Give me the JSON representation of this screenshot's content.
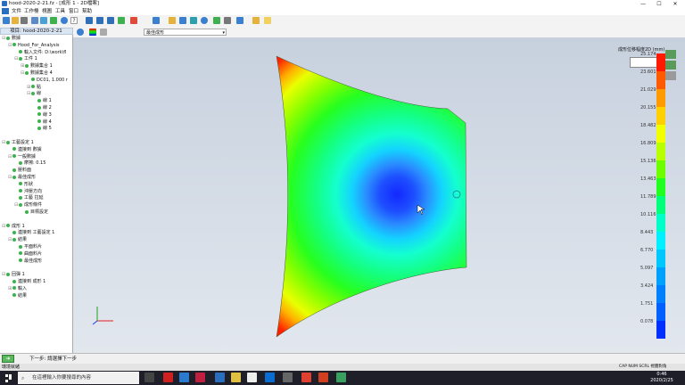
{
  "window": {
    "title": "hood-2020-2-21.fz - [成形 1 - 2D檔案]",
    "controls": [
      "—",
      "☐",
      "✕"
    ]
  },
  "menu": [
    "文件",
    "工作檯",
    "視圖",
    "工具",
    "窗口",
    "幫助"
  ],
  "toolbar": {
    "icons": [
      "save-icon",
      "open-icon",
      "print-icon",
      "settings-icon",
      "refresh-icon",
      "help-icon",
      "zoom-fit-icon",
      "zoom-in-icon",
      "rotate-icon",
      "pan-icon",
      "move-icon",
      "cube-icon",
      "layers-icon",
      "measure-icon",
      "section-icon",
      "globe-icon",
      "select-icon",
      "copy-icon",
      "calculator-icon",
      "image-icon",
      "grid-icon",
      "filter-icon"
    ]
  },
  "secondary_toolbar": {
    "result_type": "最佳成形"
  },
  "tree": {
    "header": "項目: hood-2020-2-21",
    "items": [
      {
        "label": "數據",
        "level": 0,
        "expander": "⊟"
      },
      {
        "label": "Hood_For_Analysis",
        "level": 1,
        "expander": "⊟"
      },
      {
        "label": "輸入文件: D:\\work\\fl",
        "level": 2,
        "expander": ""
      },
      {
        "label": "工件 1",
        "level": 2,
        "expander": "⊟"
      },
      {
        "label": "數據集合 1",
        "level": 3,
        "expander": "⊞"
      },
      {
        "label": "數據集合 4",
        "level": 3,
        "expander": "⊟"
      },
      {
        "label": "DC01, 1.000 r",
        "level": 4,
        "expander": ""
      },
      {
        "label": "點",
        "level": 4,
        "expander": "⊞"
      },
      {
        "label": "線",
        "level": 4,
        "expander": "⊟"
      },
      {
        "label": "線 1",
        "level": 5,
        "expander": ""
      },
      {
        "label": "線 2",
        "level": 5,
        "expander": ""
      },
      {
        "label": "線 3",
        "level": 5,
        "expander": ""
      },
      {
        "label": "線 4",
        "level": 5,
        "expander": ""
      },
      {
        "label": "線 5",
        "level": 5,
        "expander": ""
      },
      {
        "label": "",
        "level": 0,
        "expander": ""
      },
      {
        "label": "工藝設定 1",
        "level": 0,
        "expander": "⊟"
      },
      {
        "label": "連接到 數據",
        "level": 1,
        "expander": ""
      },
      {
        "label": "一般數據",
        "level": 1,
        "expander": "⊟"
      },
      {
        "label": "摩擦: 0.15",
        "level": 2,
        "expander": ""
      },
      {
        "label": "壓料面",
        "level": 1,
        "expander": ""
      },
      {
        "label": "最佳成形",
        "level": 1,
        "expander": "⊟"
      },
      {
        "label": "形狀",
        "level": 2,
        "expander": ""
      },
      {
        "label": "沖壓方向",
        "level": 2,
        "expander": ""
      },
      {
        "label": "工藝 拉延",
        "level": 2,
        "expander": ""
      },
      {
        "label": "成形條件",
        "level": 2,
        "expander": "⊟"
      },
      {
        "label": "目標設定",
        "level": 3,
        "expander": ""
      },
      {
        "label": "",
        "level": 0,
        "expander": ""
      },
      {
        "label": "成形 1",
        "level": 0,
        "expander": "⊟"
      },
      {
        "label": "連接到 工藝設定 1",
        "level": 1,
        "expander": ""
      },
      {
        "label": "結果",
        "level": 1,
        "expander": "⊟"
      },
      {
        "label": "平面料片",
        "level": 2,
        "expander": ""
      },
      {
        "label": "曲面料片",
        "level": 2,
        "expander": ""
      },
      {
        "label": "最佳成形",
        "level": 2,
        "expander": ""
      },
      {
        "label": "",
        "level": 0,
        "expander": ""
      },
      {
        "label": "回彈 1",
        "level": 0,
        "expander": "⊟"
      },
      {
        "label": "連接到 成形 1",
        "level": 1,
        "expander": ""
      },
      {
        "label": "輸入",
        "level": 1,
        "expander": "⊞"
      },
      {
        "label": "結果",
        "level": 1,
        "expander": ""
      }
    ]
  },
  "legend": {
    "title": "成形位移幅度2D (mm)",
    "values": [
      "25.174",
      "23.601",
      "21.029",
      "20.155",
      "18.482",
      "16.809",
      "15.136",
      "13.463",
      "11.789",
      "10.116",
      "8.443",
      "6.770",
      "5.097",
      "3.424",
      "1.751",
      "0.078"
    ],
    "colors": [
      "#ff1a00",
      "#ff5a00",
      "#ff9a00",
      "#ffd000",
      "#f2ff00",
      "#b8ff00",
      "#6dff00",
      "#20ff20",
      "#00ff7a",
      "#00ffc8",
      "#00f0ff",
      "#00c8ff",
      "#00a0ff",
      "#0080ff",
      "#0060ff",
      "#0030ff"
    ]
  },
  "status": {
    "next_label": "下一步: 請選擇下一步",
    "ready": "環境就緒",
    "indicators": "CAP NUM SCRL 視圖對角"
  },
  "taskbar": {
    "search_placeholder": "在這裡輸入你要搜尋的內容",
    "time": "0:46",
    "date": "2020/2/25"
  }
}
